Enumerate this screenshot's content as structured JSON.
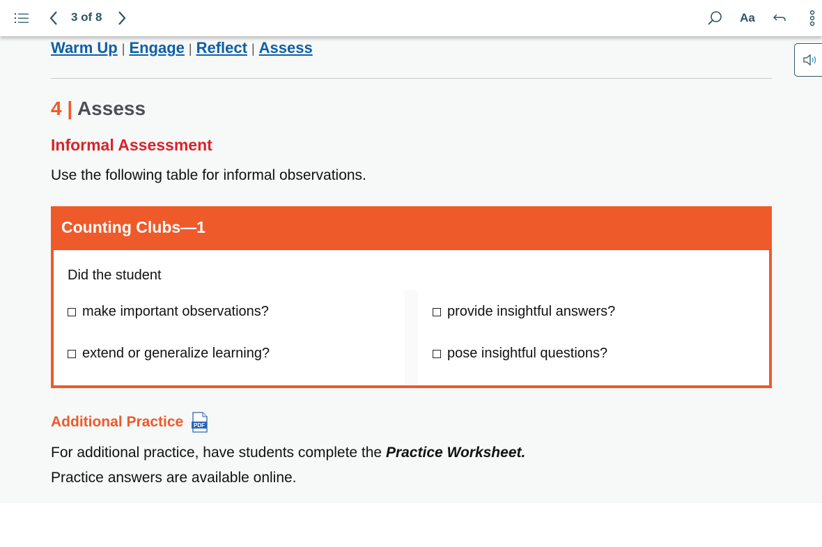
{
  "topbar": {
    "toc_icon": "list-icon",
    "prev_icon": "chevron-left-icon",
    "page_indicator": "3 of 8",
    "next_icon": "chevron-right-icon",
    "search_icon": "search-icon",
    "font_label": "Aa",
    "back_icon": "undo-arrow-icon",
    "more_icon": "more-vertical-icon"
  },
  "audio_button": {
    "icon": "speaker-icon"
  },
  "section_nav": {
    "links": [
      "Warm Up",
      "Engage",
      "Reflect",
      "Assess"
    ],
    "separator": "|"
  },
  "section": {
    "number": "4",
    "divider": "|",
    "title": "Assess"
  },
  "informal": {
    "title": "Informal Assessment",
    "intro": "Use the following table for informal observations."
  },
  "table": {
    "title": "Counting Clubs—1",
    "prompt": "Did the student",
    "items": [
      "make important observations?",
      "extend or generalize learning?",
      "provide insightful answers?",
      "pose insightful questions?"
    ]
  },
  "additional": {
    "title": "Additional Practice",
    "pdf_label": "PDF",
    "text_before": "For additional practice, have students complete the ",
    "bold_text": "Practice Worksheet.",
    "text_after": " Practice answers are available online."
  },
  "colors": {
    "accent_orange": "#ee5a2a",
    "heading_red": "#d8232a",
    "link_blue": "#0d5fa6",
    "toolbar_teal": "#2a5563"
  }
}
